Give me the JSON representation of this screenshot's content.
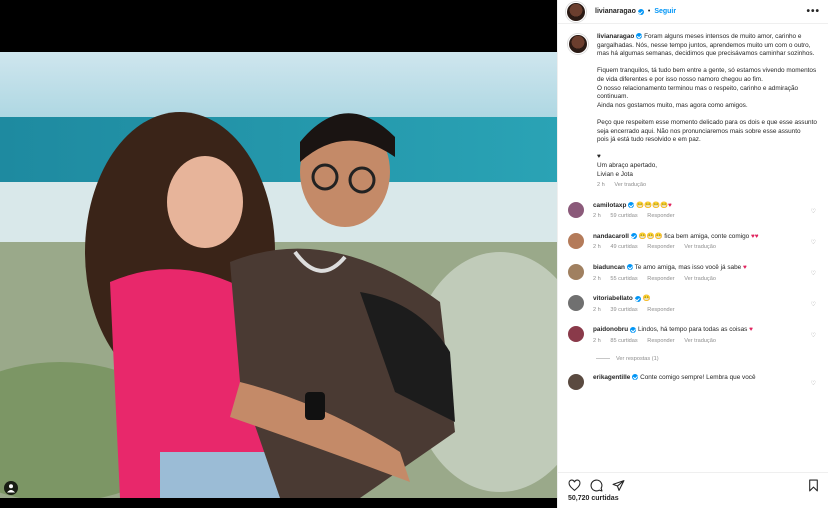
{
  "post": {
    "username": "livianaragao",
    "follow_label": "Seguir",
    "more_label": "•••",
    "likes": "50,720 curtidas"
  },
  "caption": {
    "username": "livianaragao",
    "paragraphs": [
      "Foram alguns meses intensos de muito amor, carinho e gargalhadas. Nós, nesse tempo juntos, aprendemos muito um com o outro, mas há algumas semanas, decidimos que precisávamos caminhar sozinhos.",
      "Fiquem tranquilos, tá tudo bem entre a gente, só estamos vivendo momentos de vida diferentes e por isso nosso namoro chegou ao fim.\nO nosso relacionamento terminou mas o respeito, carinho e admiração continuam.\nAinda nos gostamos muito, mas agora como amigos.",
      "Peço que respeitem esse momento delicado para os dois e que esse assunto seja encerrado aqui. Não nos pronunciaremos mais sobre esse assunto\npois já está tudo resolvido e em paz.",
      "♥\nUm abraço apertado,\nLivian e Jota"
    ],
    "time": "2 h",
    "translate": "Ver tradução"
  },
  "comments": [
    {
      "user": "camilotaxp",
      "text": "😁😁😁😁",
      "heart": "♥",
      "time": "2 h",
      "likes": "59 curtidas",
      "reply": "Responder",
      "translate": "",
      "verified": true
    },
    {
      "user": "nandacaroll",
      "text": "😁😁😁 fica bem amiga, conte comigo",
      "heart": "♥♥",
      "time": "2 h",
      "likes": "49 curtidas",
      "reply": "Responder",
      "translate": "Ver tradução",
      "verified": true
    },
    {
      "user": "biaduncan",
      "text": "Te amo amiga, mas isso você já sabe",
      "heart": "♥",
      "time": "2 h",
      "likes": "55 curtidas",
      "reply": "Responder",
      "translate": "Ver tradução",
      "verified": true
    },
    {
      "user": "vitoriabellato",
      "text": "😁",
      "heart": "",
      "time": "2 h",
      "likes": "39 curtidas",
      "reply": "Responder",
      "translate": "",
      "verified": true
    },
    {
      "user": "paidonobru",
      "text": "Lindos, há tempo para todas as coisas",
      "heart": "♥",
      "time": "2 h",
      "likes": "85 curtidas",
      "reply": "Responder",
      "translate": "Ver tradução",
      "verified": true
    },
    {
      "user": "erikagentille",
      "text": "Conte comigo sempre! Lembra que você",
      "heart": "",
      "time": "",
      "likes": "",
      "reply": "",
      "translate": "",
      "verified": true
    }
  ],
  "view_replies": "Ver respostas (1)",
  "colors": {
    "accent": "#0095f6",
    "heart": "#e0245e"
  }
}
